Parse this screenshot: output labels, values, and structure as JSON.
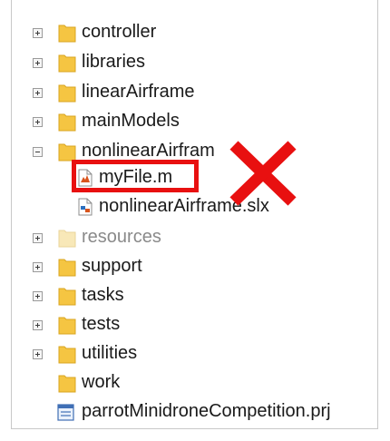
{
  "tree": {
    "items": [
      {
        "label": "controller",
        "type": "folder",
        "expander": "plus",
        "dimmed": false
      },
      {
        "label": "libraries",
        "type": "folder",
        "expander": "plus",
        "dimmed": false
      },
      {
        "label": "linearAirframe",
        "type": "folder",
        "expander": "plus",
        "dimmed": false
      },
      {
        "label": "mainModels",
        "type": "folder",
        "expander": "plus",
        "dimmed": false
      },
      {
        "label": "nonlinearAirfram",
        "type": "folder",
        "expander": "minus",
        "dimmed": false
      },
      {
        "label": "myFile.m",
        "type": "matlab-file",
        "expander": "none",
        "dimmed": false
      },
      {
        "label": "nonlinearAirframe.slx",
        "type": "simulink-model",
        "expander": "none",
        "dimmed": false
      },
      {
        "label": "resources",
        "type": "folder",
        "expander": "plus",
        "dimmed": true
      },
      {
        "label": "support",
        "type": "folder",
        "expander": "plus",
        "dimmed": false
      },
      {
        "label": "tasks",
        "type": "folder",
        "expander": "plus",
        "dimmed": false
      },
      {
        "label": "tests",
        "type": "folder",
        "expander": "plus",
        "dimmed": false
      },
      {
        "label": "utilities",
        "type": "folder",
        "expander": "plus",
        "dimmed": false
      },
      {
        "label": "work",
        "type": "folder",
        "expander": "none",
        "dimmed": false
      },
      {
        "label": "parrotMinidroneCompetition.prj",
        "type": "project-file",
        "expander": "none",
        "dimmed": false
      }
    ]
  },
  "annotation": {
    "highlight_color": "#e81010",
    "highlighted_item": "myFile.m",
    "mark": "red-x-icon"
  },
  "colors": {
    "folder": "#f5c542",
    "folder_dimmed": "#f8e8b8",
    "text": "#1a1a1a",
    "text_dimmed": "#8a8a8a"
  }
}
